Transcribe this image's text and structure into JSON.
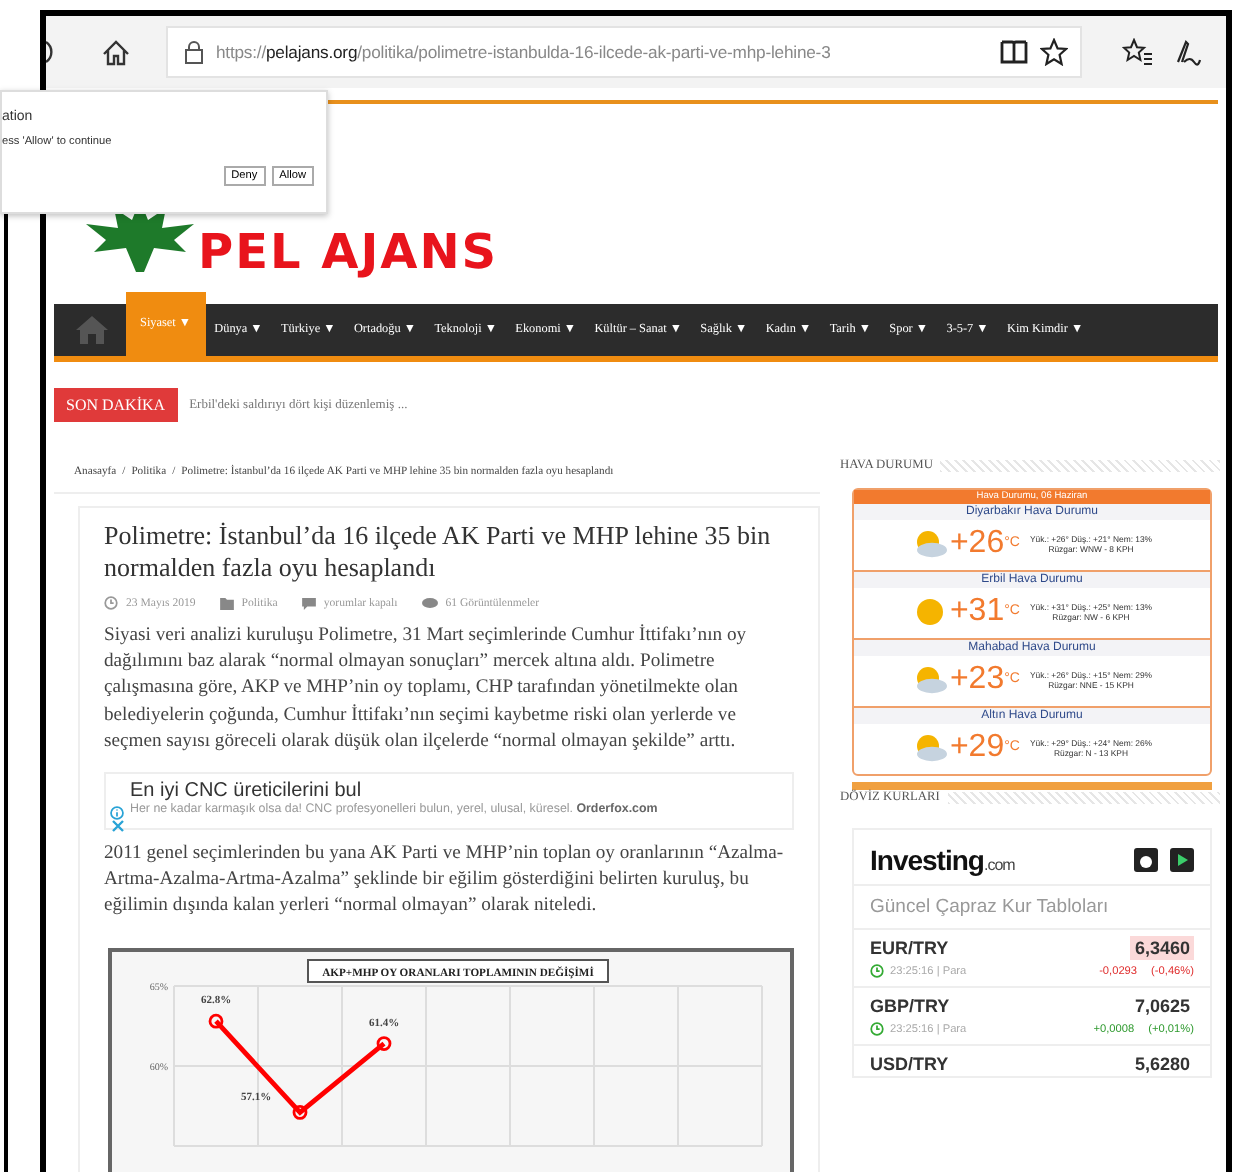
{
  "browser": {
    "url_scheme": "https://",
    "url_host": "pelajans.org",
    "url_path": "/politika/polimetre-istanbulda-16-ilcede-ak-parti-ve-mhp-lehine-3"
  },
  "permission_popup": {
    "title": "ation",
    "message": "ess 'Allow' to continue",
    "buttons": [
      "Deny",
      "Allow"
    ]
  },
  "site": {
    "logo": "PEL AJANS"
  },
  "nav": {
    "items": [
      {
        "label": "Siyaset ▼",
        "selected": true
      },
      {
        "label": "Dünya ▼",
        "selected": false
      },
      {
        "label": "Türkiye ▼",
        "selected": false
      },
      {
        "label": "Ortadoğu ▼",
        "selected": false
      },
      {
        "label": "Teknoloji ▼",
        "selected": false
      },
      {
        "label": "Ekonomi ▼",
        "selected": false
      },
      {
        "label": "Kültür – Sanat ▼",
        "selected": false
      },
      {
        "label": "Sağlık ▼",
        "selected": false
      },
      {
        "label": "Kadın ▼",
        "selected": false
      },
      {
        "label": "Tarih ▼",
        "selected": false
      },
      {
        "label": "Spor ▼",
        "selected": false
      },
      {
        "label": "3-5-7 ▼",
        "selected": false
      },
      {
        "label": "Kim Kimdir ▼",
        "selected": false
      }
    ]
  },
  "breaking": {
    "label": "SON DAKİKA",
    "headline": "Erbil'deki saldırıyı dört kişi düzenlemiş ..."
  },
  "breadcrumb": {
    "separator": "/",
    "items": [
      "Anasayfa",
      "Politika",
      "Polimetre: İstanbul’da 16 ilçede AK Parti ve MHP lehine 35 bin normalden fazla oyu hesaplandı"
    ]
  },
  "article": {
    "title": "Polimetre: İstanbul’da 16 ilçede AK Parti ve MHP lehine 35 bin normalden fazla oyu hesaplandı",
    "meta": {
      "date": "23 Mayıs 2019",
      "category": "Politika",
      "comments": "yorumlar kapalı",
      "views": "61 Görüntülenmeler"
    },
    "paragraphs": [
      "Siyasi veri analizi kuruluşu Polimetre, 31 Mart seçimlerinde Cumhur İttifakı’nın oy dağılımını baz alarak “normal olmayan sonuçları” mercek altına aldı. Polimetre çalışmasına göre, AKP ve MHP’nin oy toplamı, CHP tarafından yönetilmekte olan belediyelerin çoğunda, Cumhur İttifakı’nın seçimi kaybetme riski olan yerlerde ve seçmen sayısı göreceli olarak düşük olan ilçelerde “normal olmayan şekilde” arttı.",
      "2011 genel seçimlerinden bu yana AK Parti ve MHP’nin toplan oy oranlarının “Azalma-Artma-Azalma-Artma-Azalma” şeklinde bir eğilim gösterdiğini belirten kuruluş, bu eğilimin dışında kalan yerleri “normal olmayan” olarak niteledi."
    ],
    "ad": {
      "title": "En iyi CNC üreticilerini bul",
      "text": "Her ne kadar karmaşık olsa da! CNC profesyonelleri bulun, yerel, ulusal, küresel.",
      "source": "Orderfox.com"
    },
    "chart_data": {
      "type": "line",
      "title": "AKP+MHP OY ORANLARI TOPLAMININ DEĞİŞİMİ",
      "categories": [
        null,
        null,
        null,
        null,
        null,
        null,
        null
      ],
      "series": [
        {
          "color": "#ff0000",
          "marker": "circle",
          "values": [
            62.8,
            57.1,
            61.4,
            null,
            null,
            null,
            null
          ]
        }
      ],
      "ylim": [
        55,
        65
      ],
      "yticks": [
        {
          "value": 60,
          "label": "60%"
        },
        {
          "value": 65,
          "label": "65%"
        }
      ],
      "value_labels": [
        "62.8%",
        "57.1%",
        "61.4%"
      ]
    }
  },
  "weather": {
    "heading": "HAVA DURUMU",
    "widget_title": "Hava Durumu, 06 Haziran",
    "cities": [
      {
        "name": "Diyarbakır Hava Durumu",
        "kind": "cloudy",
        "temp": "+26",
        "unit": "°C",
        "details": "Yük.: +26° Düş.: +21° Nem: 13%",
        "wind": "Rüzgar: WNW - 8 KPH"
      },
      {
        "name": "Erbil Hava Durumu",
        "kind": "sunny",
        "temp": "+31",
        "unit": "°C",
        "details": "Yük.: +31° Düş.: +25° Nem: 13%",
        "wind": "Rüzgar: NW - 6 KPH"
      },
      {
        "name": "Mahabad Hava Durumu",
        "kind": "cloudy",
        "temp": "+23",
        "unit": "°C",
        "details": "Yük.: +26° Düş.: +15° Nem: 29%",
        "wind": "Rüzgar: NNE - 15 KPH"
      },
      {
        "name": "Altın Hava Durumu",
        "kind": "cloudy",
        "temp": "+29",
        "unit": "°C",
        "details": "Yük.: +29° Düş.: +24° Nem: 26%",
        "wind": "Rüzgar: N - 13 KPH"
      }
    ]
  },
  "currency": {
    "heading": "DÖVİZ KURLARI",
    "brand": "Investing",
    "brand_suffix": ".com",
    "subtitle": "Güncel Çapraz Kur Tabloları",
    "rows": [
      {
        "pair": "EUR/TRY",
        "price": "6,3460",
        "highlighted": true,
        "time": "23:25:16 | Para",
        "kind": "down",
        "change": "-0,0293",
        "percent": "(-0,46%)"
      },
      {
        "pair": "GBP/TRY",
        "price": "7,0625",
        "highlighted": false,
        "time": "23:25:16 | Para",
        "kind": "up",
        "change": "+0,0008",
        "percent": "(+0,01%)"
      },
      {
        "pair": "USD/TRY",
        "price": "5,6280",
        "highlighted": false
      }
    ]
  }
}
